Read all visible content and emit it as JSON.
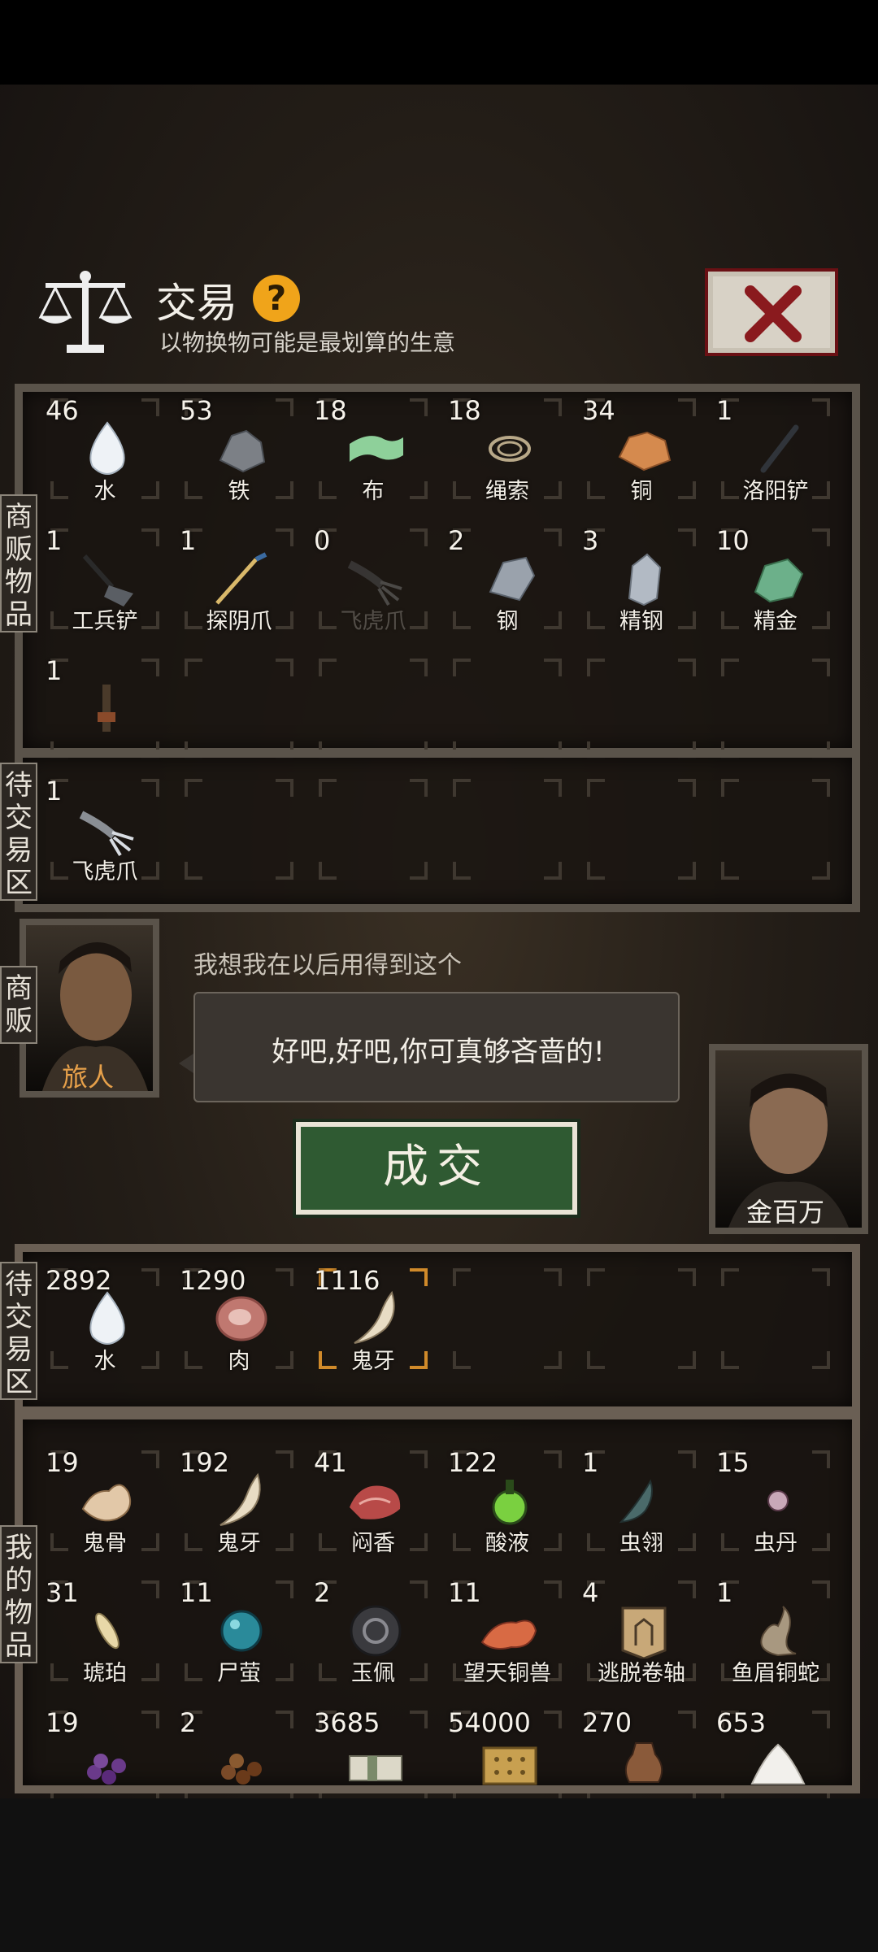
{
  "header": {
    "title": "交易",
    "subtitle": "以物换物可能是最划算的生意",
    "help_label": "?"
  },
  "tabs": {
    "merchant_items": "商\n贩\n物\n品",
    "pending_top": "待\n交\n易\n区",
    "merchant": "商\n贩",
    "pending_bottom": "待\n交\n易\n区",
    "my_items": "我\n的\n物\n品"
  },
  "merchant_items": [
    {
      "count": "46",
      "name": "水",
      "icon": "water-drop-icon"
    },
    {
      "count": "53",
      "name": "铁",
      "icon": "iron-ore-icon"
    },
    {
      "count": "18",
      "name": "布",
      "icon": "cloth-icon"
    },
    {
      "count": "18",
      "name": "绳索",
      "icon": "rope-icon"
    },
    {
      "count": "34",
      "name": "铜",
      "icon": "copper-ore-icon"
    },
    {
      "count": "1",
      "name": "洛阳铲",
      "icon": "luoyang-shovel-icon"
    },
    {
      "count": "1",
      "name": "工兵铲",
      "icon": "sapper-shovel-icon"
    },
    {
      "count": "1",
      "name": "探阴爪",
      "icon": "probe-claw-icon"
    },
    {
      "count": "0",
      "name": "飞虎爪",
      "icon": "flying-tiger-claw-icon"
    },
    {
      "count": "2",
      "name": "钢",
      "icon": "steel-icon"
    },
    {
      "count": "3",
      "name": "精钢",
      "icon": "fine-steel-icon"
    },
    {
      "count": "10",
      "name": "精金",
      "icon": "fine-gold-icon"
    },
    {
      "count": "1",
      "name": "",
      "icon": "tool-icon"
    }
  ],
  "merchant_pending": [
    {
      "count": "1",
      "name": "飞虎爪",
      "icon": "flying-tiger-claw-icon"
    }
  ],
  "dialog": {
    "merchant_name": "旅人",
    "player_name": "金百万",
    "merchant_line": "我想我在以后用得到这个",
    "player_line": "好吧,好吧,你可真够吝啬的!",
    "deal_label": "成交"
  },
  "my_pending": [
    {
      "count": "2892",
      "name": "水",
      "icon": "water-drop-icon"
    },
    {
      "count": "1290",
      "name": "肉",
      "icon": "meat-icon"
    },
    {
      "count": "1116",
      "name": "鬼牙",
      "icon": "ghost-tooth-icon",
      "selected": true
    }
  ],
  "my_items": [
    {
      "count": "19",
      "name": "鬼骨",
      "icon": "ghost-bone-icon"
    },
    {
      "count": "192",
      "name": "鬼牙",
      "icon": "ghost-tooth-icon"
    },
    {
      "count": "41",
      "name": "闷香",
      "icon": "incense-icon"
    },
    {
      "count": "122",
      "name": "酸液",
      "icon": "acid-flask-icon"
    },
    {
      "count": "1",
      "name": "虫翎",
      "icon": "insect-feather-icon"
    },
    {
      "count": "15",
      "name": "虫丹",
      "icon": "insect-pill-icon"
    },
    {
      "count": "31",
      "name": "琥珀",
      "icon": "amber-icon"
    },
    {
      "count": "11",
      "name": "尸萤",
      "icon": "corpse-firefly-icon"
    },
    {
      "count": "2",
      "name": "玉佩",
      "icon": "jade-pendant-icon"
    },
    {
      "count": "11",
      "name": "望天铜兽",
      "icon": "bronze-beast-icon"
    },
    {
      "count": "4",
      "name": "逃脱卷轴",
      "icon": "escape-scroll-icon"
    },
    {
      "count": "1",
      "name": "鱼眉铜蛇",
      "icon": "bronze-snake-icon"
    },
    {
      "count": "19",
      "name": "",
      "icon": "purple-beads-icon"
    },
    {
      "count": "2",
      "name": "",
      "icon": "brown-beads-icon"
    },
    {
      "count": "3685",
      "name": "",
      "icon": "money-stack-icon"
    },
    {
      "count": "54000",
      "name": "",
      "icon": "gold-plate-icon"
    },
    {
      "count": "270",
      "name": "",
      "icon": "pottery-icon"
    },
    {
      "count": "653",
      "name": "",
      "icon": "salt-pile-icon"
    }
  ],
  "colors": {
    "accent": "#f0a41a",
    "deal_green": "#2f5a32",
    "close_red": "#8a1a1e",
    "selected_corner": "#d08a2a"
  }
}
